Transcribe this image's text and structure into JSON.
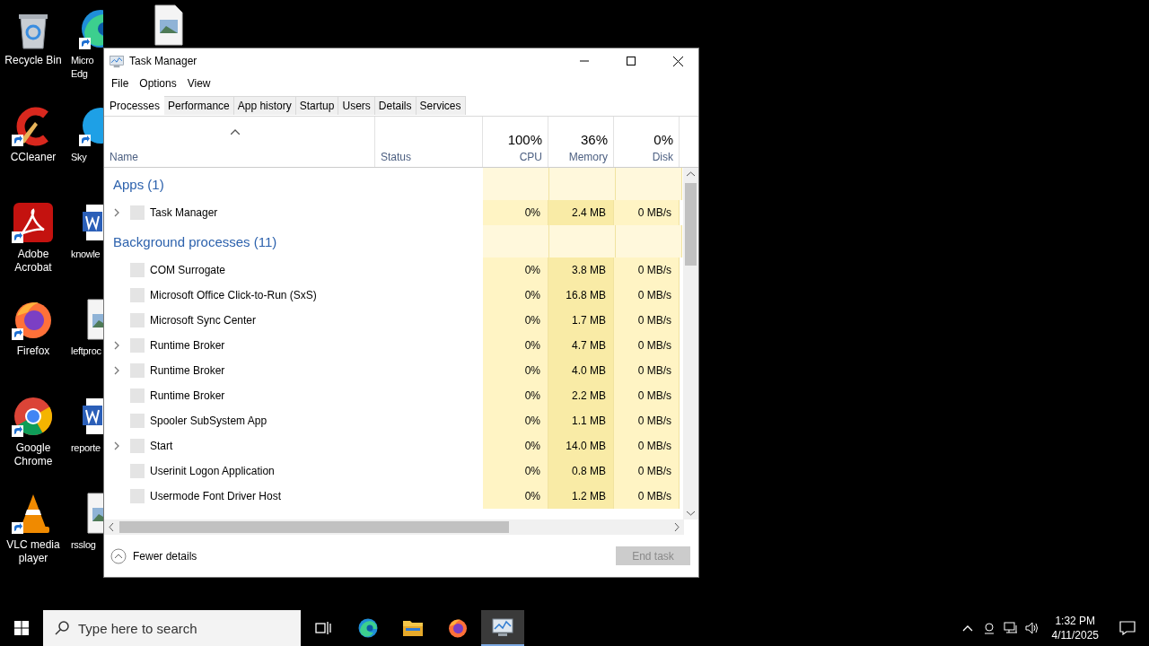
{
  "desktop": {
    "column_1": [
      {
        "kind": "recycle",
        "label": "Recycle Bin",
        "shortcut": false
      },
      {
        "kind": "ccleaner",
        "label": "CCleaner",
        "shortcut": true
      },
      {
        "kind": "acrobat",
        "label": "Adobe Acrobat",
        "shortcut": true
      },
      {
        "kind": "firefox",
        "label": "Firefox",
        "shortcut": true
      },
      {
        "kind": "chrome",
        "label": "Google Chrome",
        "shortcut": true
      },
      {
        "kind": "vlc",
        "label": "VLC media player",
        "shortcut": true
      }
    ],
    "column_2": [
      {
        "kind": "edge",
        "label": "Micro Edg",
        "shortcut": true
      },
      {
        "kind": "skype",
        "label": "Sky",
        "shortcut": true
      },
      {
        "kind": "word",
        "label": "knowle",
        "shortcut": false
      },
      {
        "kind": "image",
        "label": "leftproc",
        "shortcut": false
      },
      {
        "kind": "word",
        "label": "reporte",
        "shortcut": false
      },
      {
        "kind": "image",
        "label": "rsslog",
        "shortcut": false
      }
    ],
    "column_3": [
      {
        "kind": "image",
        "shortcut": false
      }
    ]
  },
  "window": {
    "title": "Task Manager",
    "menu": [
      "File",
      "Options",
      "View"
    ],
    "tabs": [
      {
        "label": "Processes",
        "selected": true
      },
      {
        "label": "Performance",
        "selected": false
      },
      {
        "label": "App history",
        "selected": false
      },
      {
        "label": "Startup",
        "selected": false
      },
      {
        "label": "Users",
        "selected": false
      },
      {
        "label": "Details",
        "selected": false
      },
      {
        "label": "Services",
        "selected": false
      }
    ],
    "columns": {
      "name": "Name",
      "status": "Status",
      "metrics": [
        {
          "percent": "100%",
          "label": "CPU"
        },
        {
          "percent": "36%",
          "label": "Memory"
        },
        {
          "percent": "0%",
          "label": "Disk"
        }
      ]
    },
    "groups": [
      {
        "title": "Apps (1)",
        "rows": [
          {
            "name": "Task Manager",
            "expandable": true,
            "values": [
              "0%",
              "2.4 MB",
              "0 MB/s"
            ]
          }
        ]
      },
      {
        "title": "Background processes (11)",
        "rows": [
          {
            "name": "COM Surrogate",
            "expandable": false,
            "values": [
              "0%",
              "3.8 MB",
              "0 MB/s"
            ]
          },
          {
            "name": "Microsoft Office Click-to-Run (SxS)",
            "expandable": false,
            "values": [
              "0%",
              "16.8 MB",
              "0 MB/s"
            ]
          },
          {
            "name": "Microsoft Sync Center",
            "expandable": false,
            "values": [
              "0%",
              "1.7 MB",
              "0 MB/s"
            ]
          },
          {
            "name": "Runtime Broker",
            "expandable": true,
            "values": [
              "0%",
              "4.7 MB",
              "0 MB/s"
            ]
          },
          {
            "name": "Runtime Broker",
            "expandable": true,
            "values": [
              "0%",
              "4.0 MB",
              "0 MB/s"
            ]
          },
          {
            "name": "Runtime Broker",
            "expandable": false,
            "values": [
              "0%",
              "2.2 MB",
              "0 MB/s"
            ]
          },
          {
            "name": "Spooler SubSystem App",
            "expandable": false,
            "values": [
              "0%",
              "1.1 MB",
              "0 MB/s"
            ]
          },
          {
            "name": "Start",
            "expandable": true,
            "values": [
              "0%",
              "14.0 MB",
              "0 MB/s"
            ]
          },
          {
            "name": "Userinit Logon Application",
            "expandable": false,
            "values": [
              "0%",
              "0.8 MB",
              "0 MB/s"
            ]
          },
          {
            "name": "Usermode Font Driver Host",
            "expandable": false,
            "values": [
              "0%",
              "1.2 MB",
              "0 MB/s"
            ]
          }
        ]
      }
    ],
    "footer": {
      "details_toggle": "Fewer details",
      "end_task": {
        "label": "End task",
        "disabled": true
      }
    }
  },
  "taskbar": {
    "search": {
      "placeholder": "Type here to search"
    },
    "apps": [
      {
        "kind": "edge",
        "active": false
      },
      {
        "kind": "explorer",
        "active": false
      },
      {
        "kind": "firefox",
        "active": false
      },
      {
        "kind": "taskmgr",
        "active": true
      }
    ],
    "time": "1:32 PM",
    "date": "4/11/2025"
  }
}
